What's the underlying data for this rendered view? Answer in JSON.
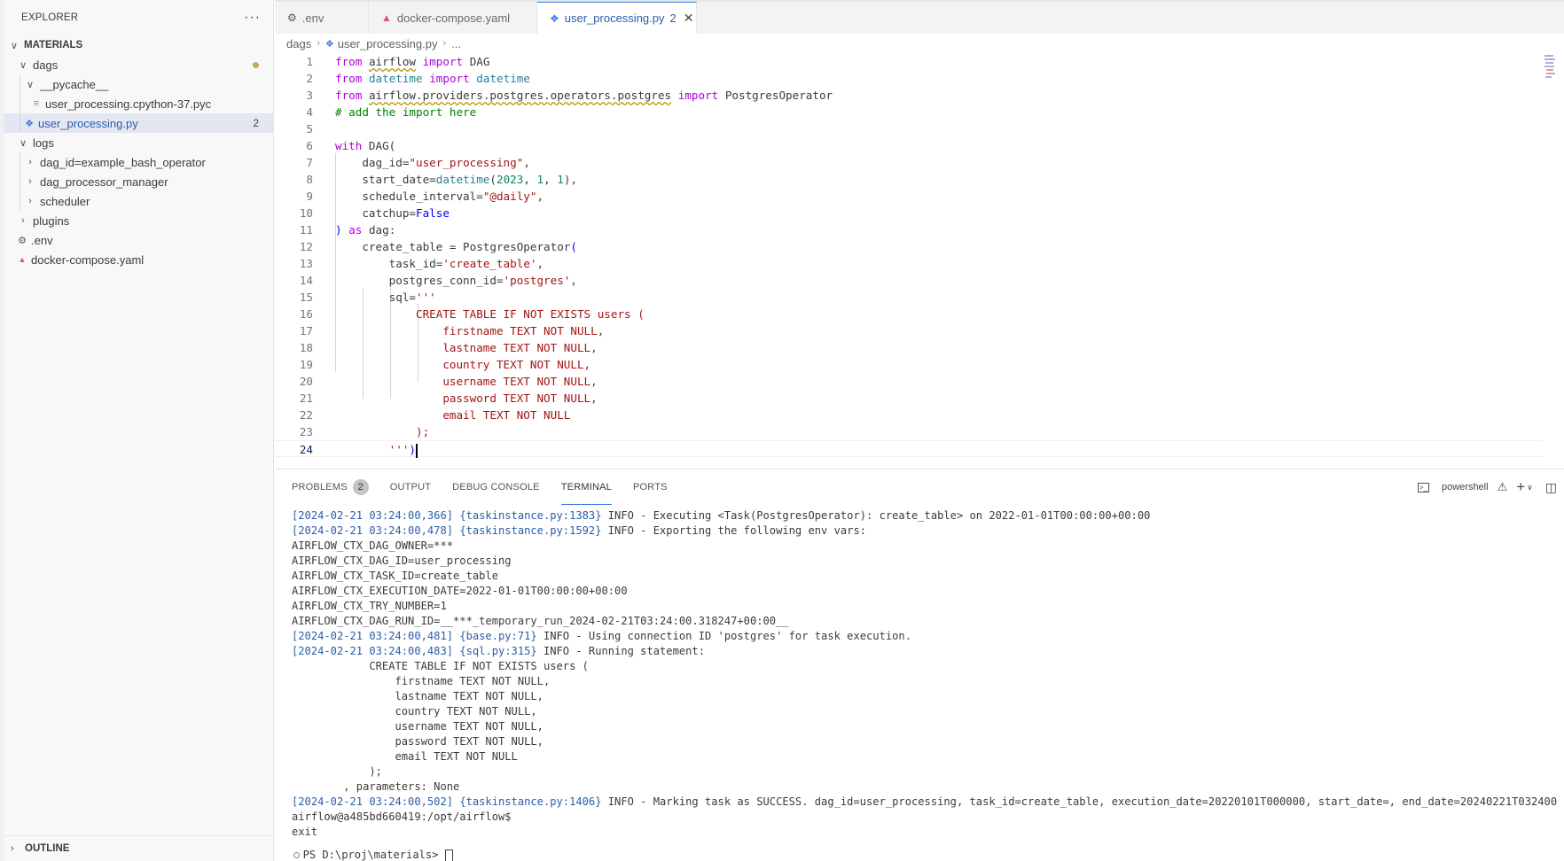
{
  "explorer": {
    "title": "EXPLORER",
    "more": "···",
    "root": "MATERIALS",
    "items": [
      {
        "label": "dags",
        "level": 1,
        "type": "folder-open"
      },
      {
        "label": "__pycache__",
        "level": 2,
        "type": "folder-open"
      },
      {
        "label": "user_processing.cpython-37.pyc",
        "level": 3,
        "type": "file"
      },
      {
        "label": "user_processing.py",
        "level": 2,
        "type": "py",
        "badge": "2"
      },
      {
        "label": "logs",
        "level": 1,
        "type": "folder-open"
      },
      {
        "label": "dag_id=example_bash_operator",
        "level": 2,
        "type": "folder"
      },
      {
        "label": "dag_processor_manager",
        "level": 2,
        "type": "folder"
      },
      {
        "label": "scheduler",
        "level": 2,
        "type": "folder"
      },
      {
        "label": "plugins",
        "level": 1,
        "type": "folder"
      },
      {
        "label": ".env",
        "level": 1,
        "type": "gear"
      },
      {
        "label": "docker-compose.yaml",
        "level": 1,
        "type": "docker"
      }
    ],
    "outline": "OUTLINE"
  },
  "tabs": [
    {
      "label": ".env",
      "icon": "gear-icon"
    },
    {
      "label": "docker-compose.yaml",
      "icon": "docker-icon"
    },
    {
      "label": "user_processing.py",
      "icon": "python-icon",
      "count": "2",
      "close": "✕"
    }
  ],
  "breadcrumb": {
    "folder": "dags",
    "file": "user_processing.py",
    "more": "..."
  },
  "editor": {
    "line_numbers": [
      "1",
      "2",
      "3",
      "4",
      "5",
      "6",
      "7",
      "8",
      "9",
      "10",
      "11",
      "12",
      "13",
      "14",
      "15",
      "16",
      "17",
      "18",
      "19",
      "20",
      "21",
      "22",
      "23",
      "24"
    ],
    "current_line": 24
  },
  "panel": {
    "tabs": [
      {
        "label": "PROBLEMS",
        "count": "2"
      },
      {
        "label": "OUTPUT"
      },
      {
        "label": "DEBUG CONSOLE"
      },
      {
        "label": "TERMINAL"
      },
      {
        "label": "PORTS"
      }
    ],
    "shell": "powershell",
    "terminal_lines": [
      {
        "ts": "[2024-02-21 03:24:00,366]",
        "file": "{taskinstance.py:1383}",
        "msg": " INFO - Executing <Task(PostgresOperator): create_table> on 2022-01-01T00:00:00+00:00"
      },
      {
        "ts": "[2024-02-21 03:24:00,478]",
        "file": "{taskinstance.py:1592}",
        "msg": " INFO - Exporting the following env vars:"
      },
      {
        "ts": "",
        "file": "",
        "msg": "AIRFLOW_CTX_DAG_OWNER=***"
      },
      {
        "ts": "",
        "file": "",
        "msg": "AIRFLOW_CTX_DAG_ID=user_processing"
      },
      {
        "ts": "",
        "file": "",
        "msg": "AIRFLOW_CTX_TASK_ID=create_table"
      },
      {
        "ts": "",
        "file": "",
        "msg": "AIRFLOW_CTX_EXECUTION_DATE=2022-01-01T00:00:00+00:00"
      },
      {
        "ts": "",
        "file": "",
        "msg": "AIRFLOW_CTX_TRY_NUMBER=1"
      },
      {
        "ts": "",
        "file": "",
        "msg": "AIRFLOW_CTX_DAG_RUN_ID=__***_temporary_run_2024-02-21T03:24:00.318247+00:00__"
      },
      {
        "ts": "[2024-02-21 03:24:00,481]",
        "file": "{base.py:71}",
        "msg": " INFO - Using connection ID 'postgres' for task execution."
      },
      {
        "ts": "[2024-02-21 03:24:00,483]",
        "file": "{sql.py:315}",
        "msg": " INFO - Running statement:"
      },
      {
        "ts": "",
        "file": "",
        "msg": "            CREATE TABLE IF NOT EXISTS users ("
      },
      {
        "ts": "",
        "file": "",
        "msg": "                firstname TEXT NOT NULL,"
      },
      {
        "ts": "",
        "file": "",
        "msg": "                lastname TEXT NOT NULL,"
      },
      {
        "ts": "",
        "file": "",
        "msg": "                country TEXT NOT NULL,"
      },
      {
        "ts": "",
        "file": "",
        "msg": "                username TEXT NOT NULL,"
      },
      {
        "ts": "",
        "file": "",
        "msg": "                password TEXT NOT NULL,"
      },
      {
        "ts": "",
        "file": "",
        "msg": "                email TEXT NOT NULL"
      },
      {
        "ts": "",
        "file": "",
        "msg": "            );"
      },
      {
        "ts": "",
        "file": "",
        "msg": "        , parameters: None"
      },
      {
        "ts": "[2024-02-21 03:24:00,502]",
        "file": "{taskinstance.py:1406}",
        "msg": " INFO - Marking task as SUCCESS. dag_id=user_processing, task_id=create_table, execution_date=20220101T000000, start_date=, end_date=20240221T032400"
      },
      {
        "ts": "",
        "file": "",
        "msg": "airflow@a485bd660419:/opt/airflow$"
      },
      {
        "ts": "",
        "file": "",
        "msg": "exit"
      }
    ],
    "prompt": "PS D:\\proj\\materials> "
  }
}
